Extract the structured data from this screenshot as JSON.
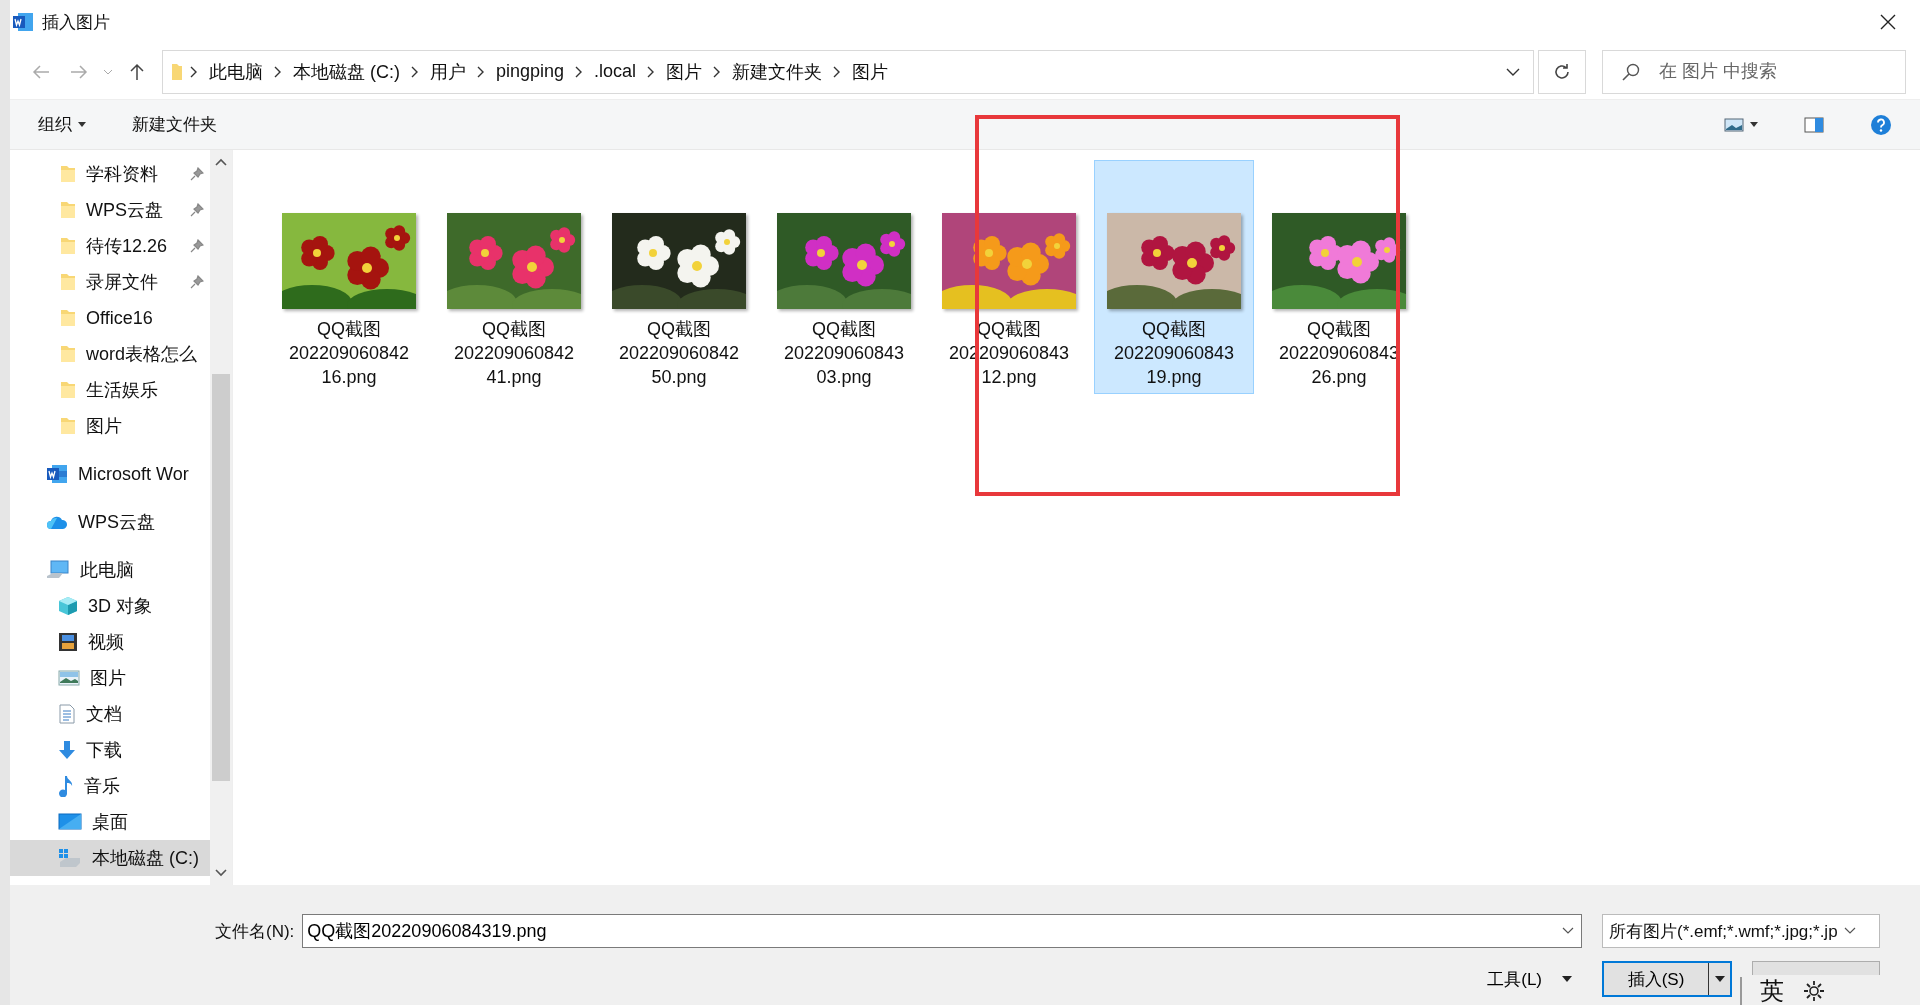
{
  "window": {
    "title": "插入图片"
  },
  "address_bar": {
    "crumbs": [
      "此电脑",
      "本地磁盘 (C:)",
      "用户",
      "pingping",
      ".local",
      "图片",
      "新建文件夹",
      "图片"
    ]
  },
  "search": {
    "placeholder": "在 图片 中搜索"
  },
  "toolbar": {
    "organize": "组织",
    "new_folder": "新建文件夹"
  },
  "sidebar": {
    "quick_access": [
      {
        "label": "学科资料",
        "pinned": true
      },
      {
        "label": "WPS云盘",
        "pinned": true
      },
      {
        "label": "待传12.26",
        "pinned": true
      },
      {
        "label": "录屏文件",
        "pinned": true
      },
      {
        "label": "Office16",
        "pinned": false
      },
      {
        "label": "word表格怎么",
        "pinned": false
      },
      {
        "label": "生活娱乐",
        "pinned": false
      },
      {
        "label": "图片",
        "pinned": false
      }
    ],
    "items": [
      {
        "kind": "word",
        "label": "Microsoft Wor",
        "selected": false
      },
      {
        "kind": "cloud",
        "label": "WPS云盘",
        "selected": false
      },
      {
        "kind": "pc",
        "label": "此电脑",
        "selected": false,
        "children": [
          {
            "kind": "cube",
            "label": "3D 对象",
            "selected": false
          },
          {
            "kind": "video",
            "label": "视频",
            "selected": false
          },
          {
            "label": "图片",
            "selected": false
          },
          {
            "kind": "doc",
            "label": "文档",
            "selected": false
          },
          {
            "kind": "download",
            "label": "下载",
            "selected": false
          },
          {
            "kind": "music",
            "label": "音乐",
            "selected": false
          },
          {
            "kind": "desktop",
            "label": "桌面",
            "selected": false
          },
          {
            "kind": "drive",
            "label": "本地磁盘 (C:)",
            "selected": true
          }
        ]
      }
    ]
  },
  "files": [
    {
      "name_lines": [
        "QQ截图",
        "202209060842",
        "16.png"
      ],
      "selected": false
    },
    {
      "name_lines": [
        "QQ截图",
        "202209060842",
        "41.png"
      ],
      "selected": false
    },
    {
      "name_lines": [
        "QQ截图",
        "202209060842",
        "50.png"
      ],
      "selected": false
    },
    {
      "name_lines": [
        "QQ截图",
        "202209060843",
        "03.png"
      ],
      "selected": false
    },
    {
      "name_lines": [
        "QQ截图",
        "202209060843",
        "12.png"
      ],
      "selected": false
    },
    {
      "name_lines": [
        "QQ截图",
        "202209060843",
        "19.png"
      ],
      "selected": true
    },
    {
      "name_lines": [
        "QQ截图",
        "202209060843",
        "26.png"
      ],
      "selected": false
    }
  ],
  "annotation": {
    "kind": "rectangle",
    "color": "#e8383b"
  },
  "footer": {
    "filename_label": "文件名(N):",
    "filename_value": "QQ截图20220906084319.png",
    "filter": "所有图片(*.emf;*.wmf;*.jpg;*.jp",
    "tools": "工具(L)",
    "insert": "插入(S)"
  },
  "ime": {
    "mode": "英"
  }
}
